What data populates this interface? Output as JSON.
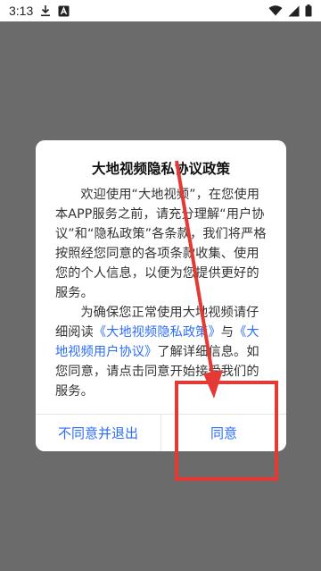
{
  "status_bar": {
    "time": "3:13",
    "icons": [
      "download-icon",
      "app-a-icon",
      "wifi-icon",
      "signal-icon",
      "battery-icon"
    ]
  },
  "dialog": {
    "title": "大地视频隐私协议政策",
    "paragraph1": "欢迎使用“大地视频”，在您使用本APP服务之前，请充分理解“用户协议”和“隐私政策”各条款，我们将严格按照经您同意的各项条款收集、使用您的个人信息，以便为您提供更好的服务。",
    "paragraph2_prefix": "为确保您正常使用大地视频请仔细阅读",
    "privacy_link": "《大地视频隐私政策》",
    "and_text": "与",
    "agreement_link": "《大地视频用户协议》",
    "paragraph2_suffix": "了解详细信息。如您同意，请点击同意开始接受我们的服务。",
    "disagree_button": "不同意并退出",
    "agree_button": "同意"
  },
  "annotation": {
    "arrow_color": "#e53935",
    "box_color": "#e53935"
  }
}
